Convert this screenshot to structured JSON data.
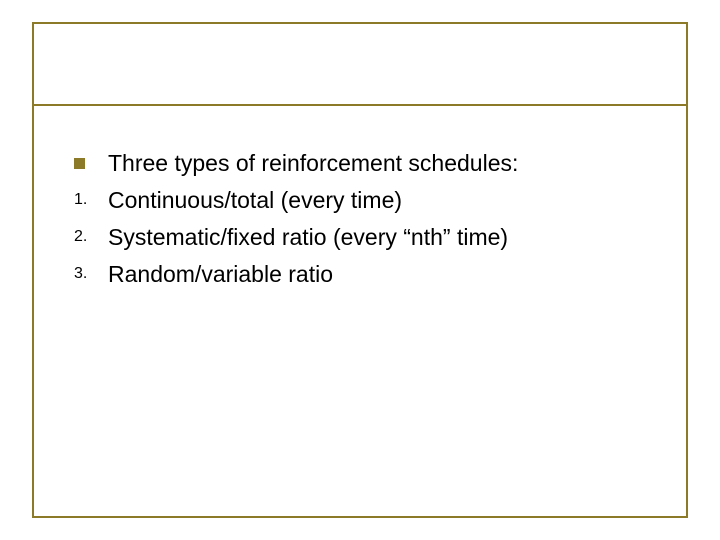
{
  "slide": {
    "heading": "Three types of reinforcement schedules:",
    "items": [
      {
        "num": "1.",
        "text": "Continuous/total (every time)"
      },
      {
        "num": "2.",
        "text": "Systematic/fixed ratio (every “nth” time)"
      },
      {
        "num": "3.",
        "text": "Random/variable ratio"
      }
    ]
  }
}
